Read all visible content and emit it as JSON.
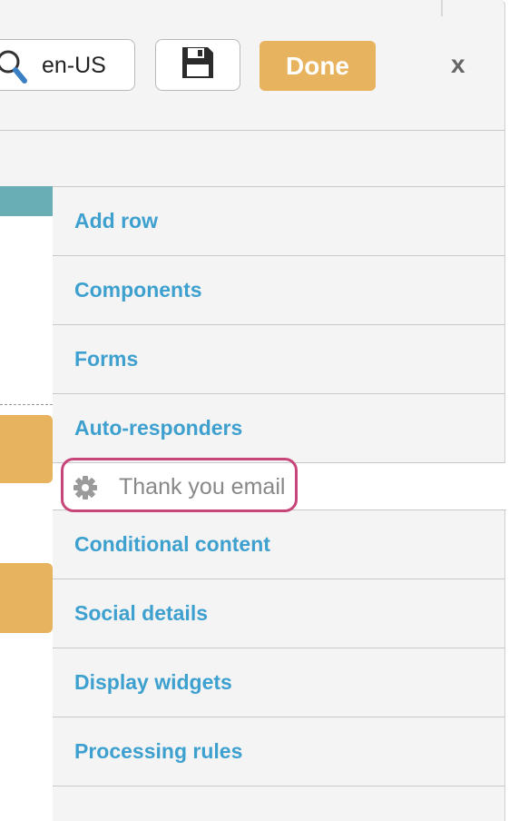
{
  "toolbar": {
    "language": "en-US",
    "language_icon": "search-icon",
    "save_icon": "floppy-disk-icon",
    "done_label": "Done",
    "close_label": "x"
  },
  "colors": {
    "accent": "#e8b35f",
    "link": "#3ea0cf",
    "highlight": "#c8457a",
    "teal": "#6aaeb5"
  },
  "menu": {
    "items": [
      {
        "label": "Add row"
      },
      {
        "label": "Components"
      },
      {
        "label": "Forms"
      },
      {
        "label": "Auto-responders"
      },
      {
        "label": "Conditional content"
      },
      {
        "label": "Social details"
      },
      {
        "label": "Display widgets"
      },
      {
        "label": "Processing rules"
      }
    ],
    "subitem": {
      "label": "Thank you email",
      "icon": "gear-icon"
    }
  }
}
